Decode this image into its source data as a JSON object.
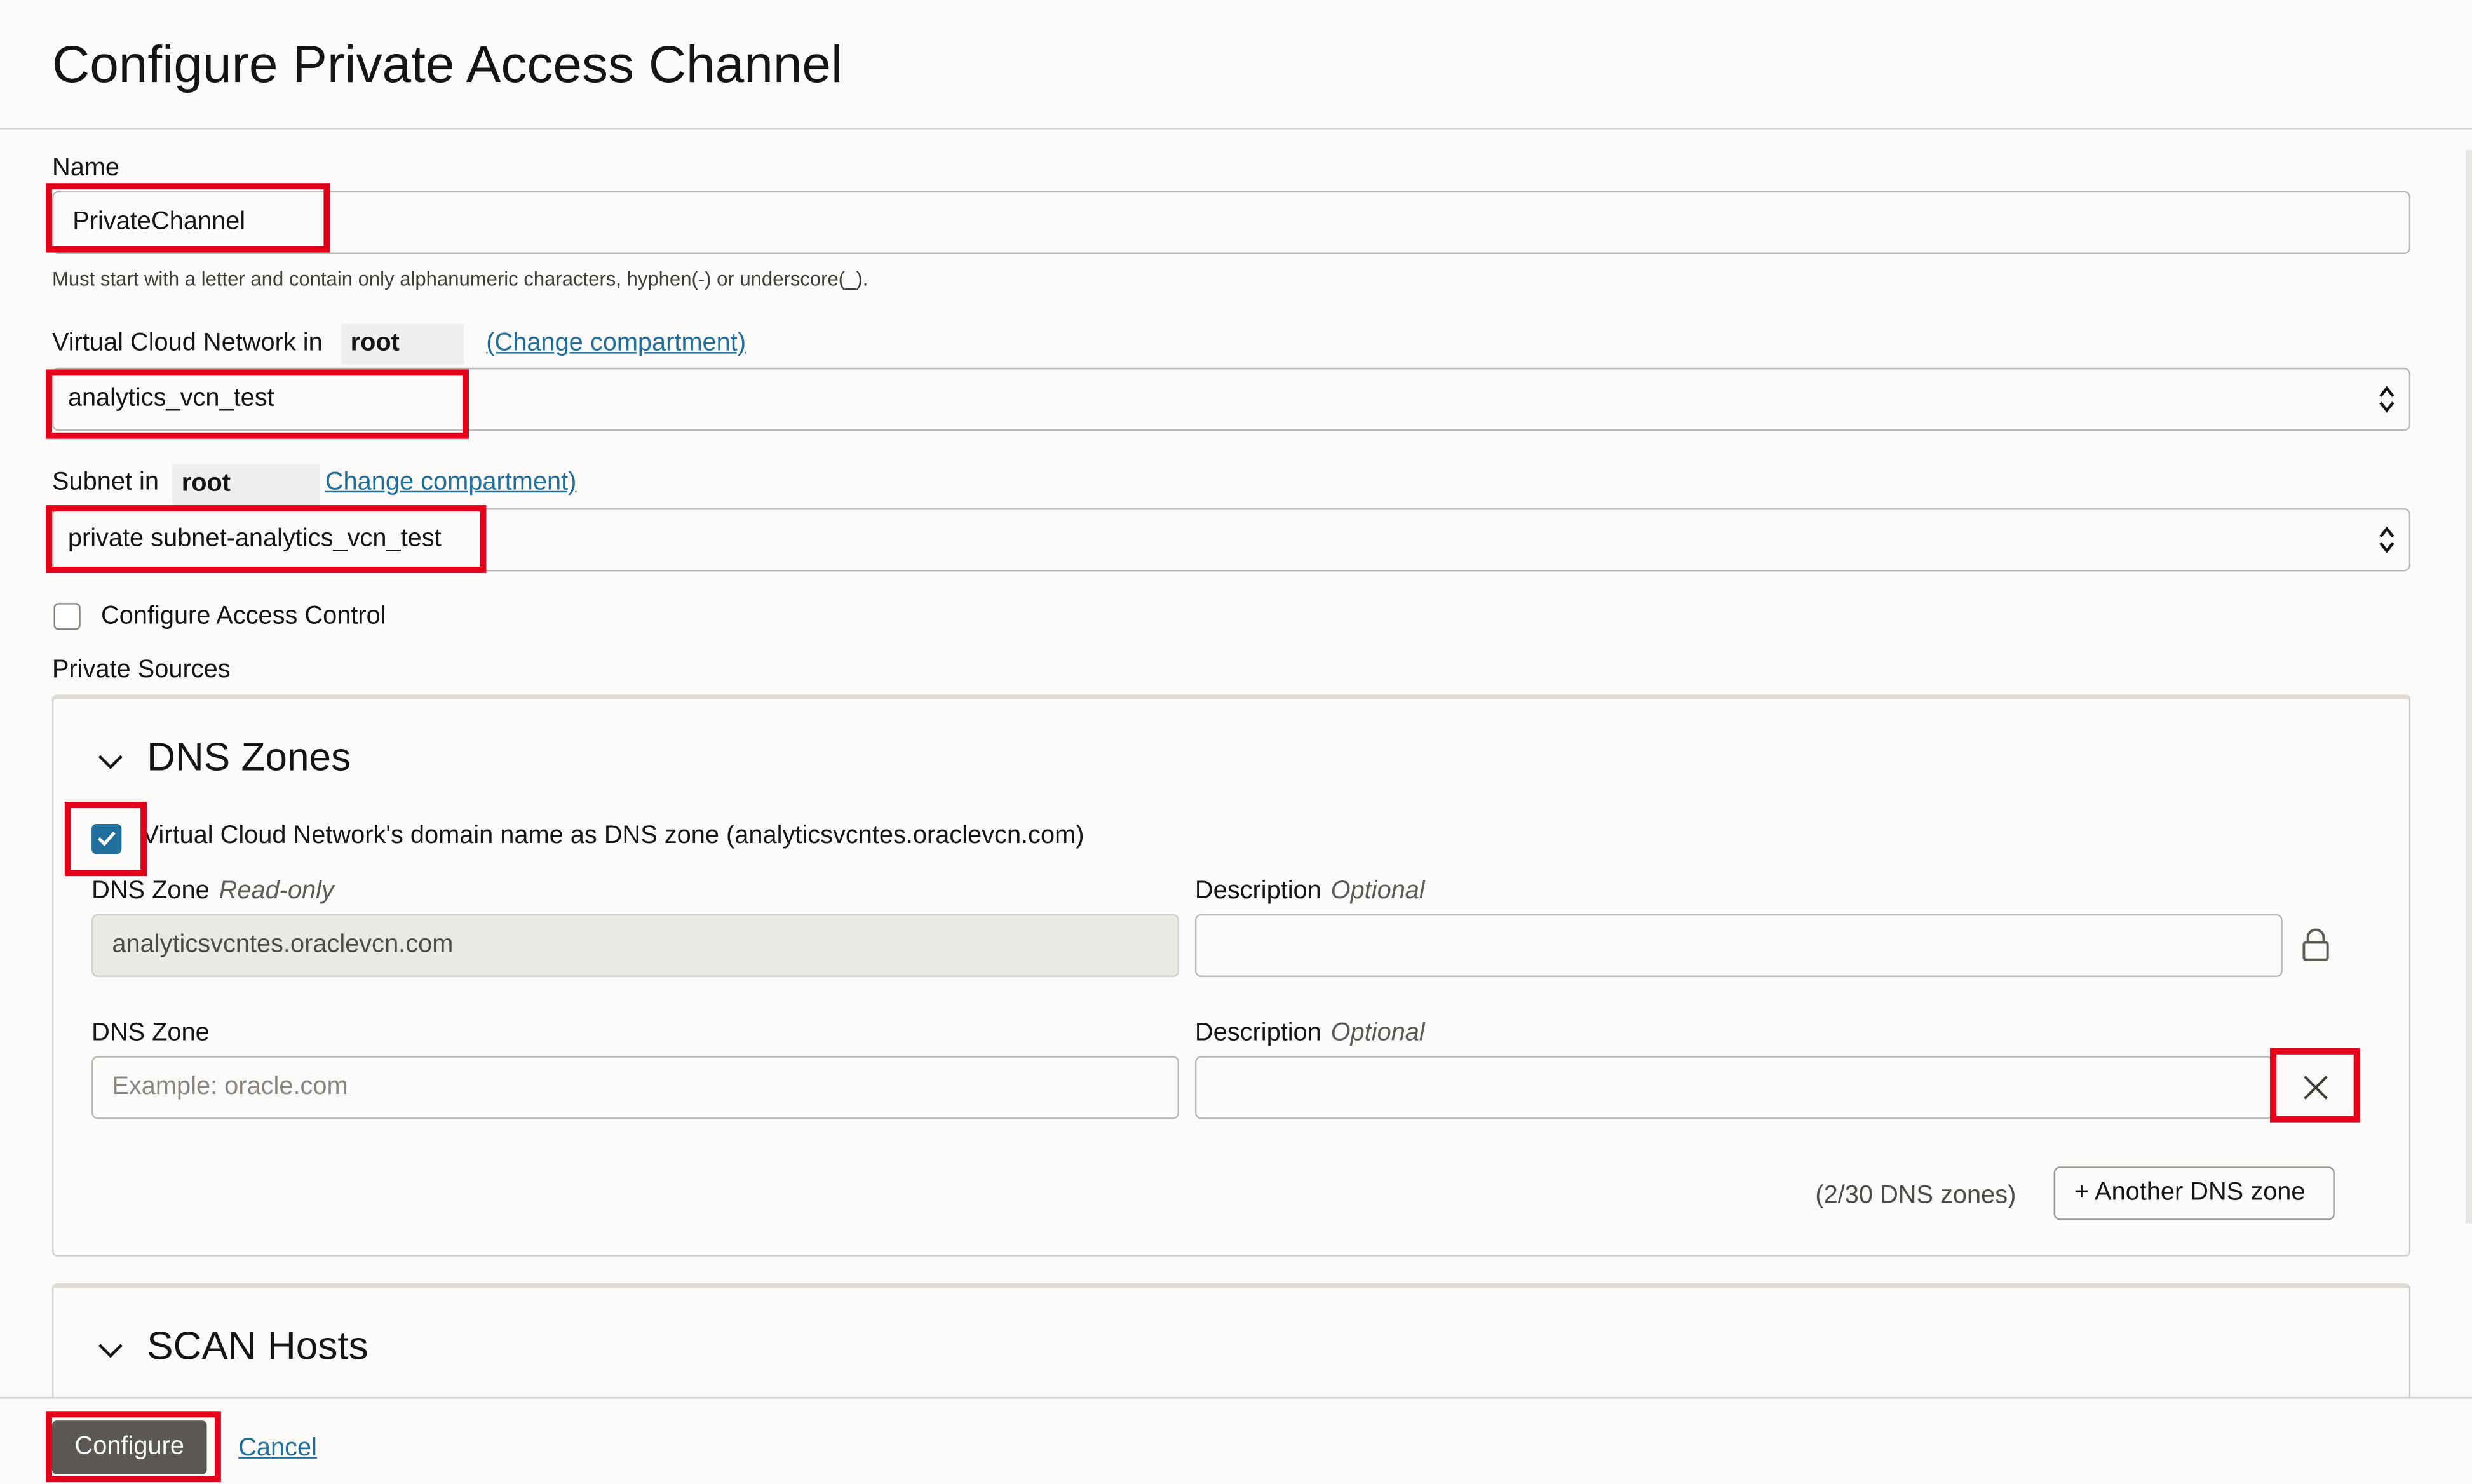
{
  "page": {
    "title": "Configure Private Access Channel"
  },
  "name_field": {
    "label": "Name",
    "value": "PrivateChannel",
    "helper": "Must start with a letter and contain only alphanumeric characters, hyphen(-) or underscore(_)."
  },
  "vcn_field": {
    "label": "Virtual Cloud Network in",
    "compartment": "root",
    "change_link": "(Change compartment)",
    "value": "analytics_vcn_test"
  },
  "subnet_field": {
    "label": "Subnet in",
    "compartment": "root",
    "change_link": "Change compartment)",
    "value": "private subnet-analytics_vcn_test"
  },
  "access_control": {
    "label": "Configure Access Control",
    "checked": false
  },
  "private_sources": {
    "label": "Private Sources"
  },
  "dns_zones": {
    "title": "DNS Zones",
    "vcn_domain_checkbox_label": "Virtual Cloud Network's domain name as DNS zone (analyticsvcntes.oraclevcn.com)",
    "vcn_domain_checked": true,
    "rows": [
      {
        "zone_label": "DNS Zone",
        "zone_qualifier": "Read-only",
        "zone_value": "analyticsvcntes.oraclevcn.com",
        "desc_label": "Description",
        "desc_qualifier": "Optional",
        "desc_value": ""
      },
      {
        "zone_label": "DNS Zone",
        "zone_placeholder": "Example: oracle.com",
        "desc_label": "Description",
        "desc_qualifier": "Optional",
        "desc_value": ""
      }
    ],
    "count_text": "(2/30 DNS zones)",
    "add_button": "+ Another DNS zone"
  },
  "scan_hosts": {
    "title": "SCAN Hosts"
  },
  "footer": {
    "configure_button": "Configure",
    "cancel_link": "Cancel"
  },
  "icons": {
    "chevron": "chevron-down-icon",
    "lock": "lock-icon",
    "remove": "close-icon",
    "select": "select-arrows-icon",
    "check": "checkmark-icon"
  },
  "colors": {
    "accent": "#1f6e9c",
    "highlight": "#e3001b",
    "primary_button": "#5b5752"
  }
}
